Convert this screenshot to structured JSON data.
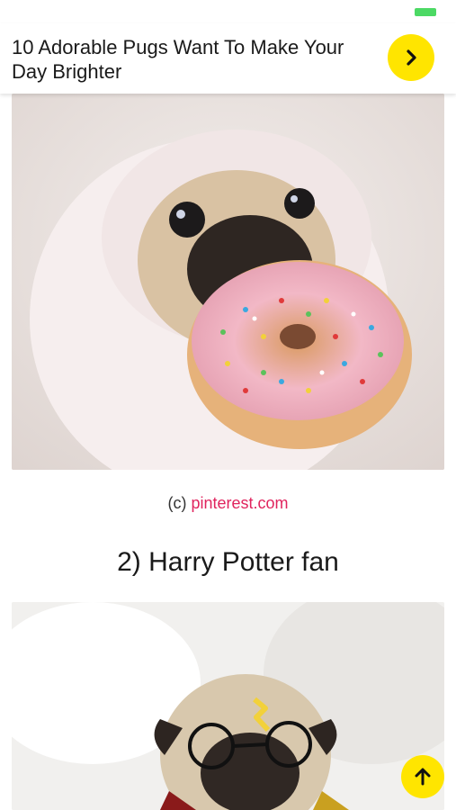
{
  "header": {
    "title": "10 Adorable Pugs Want To Make Your Day Brighter",
    "next_icon": "chevron-right-icon",
    "accent_color": "#ffe500"
  },
  "article": {
    "image1": {
      "subject": "pug in pink hoodie eating sprinkled donut"
    },
    "credit": {
      "prefix": "(c)",
      "source": "pinterest.com",
      "link_color": "#e0245e"
    },
    "section2": {
      "heading": "2) Harry Potter fan"
    },
    "image2": {
      "subject": "pug with glasses and scarf in bed"
    }
  },
  "scroll_top": {
    "icon": "arrow-up-icon"
  },
  "status_bar": {
    "battery_color": "#4cd964"
  }
}
